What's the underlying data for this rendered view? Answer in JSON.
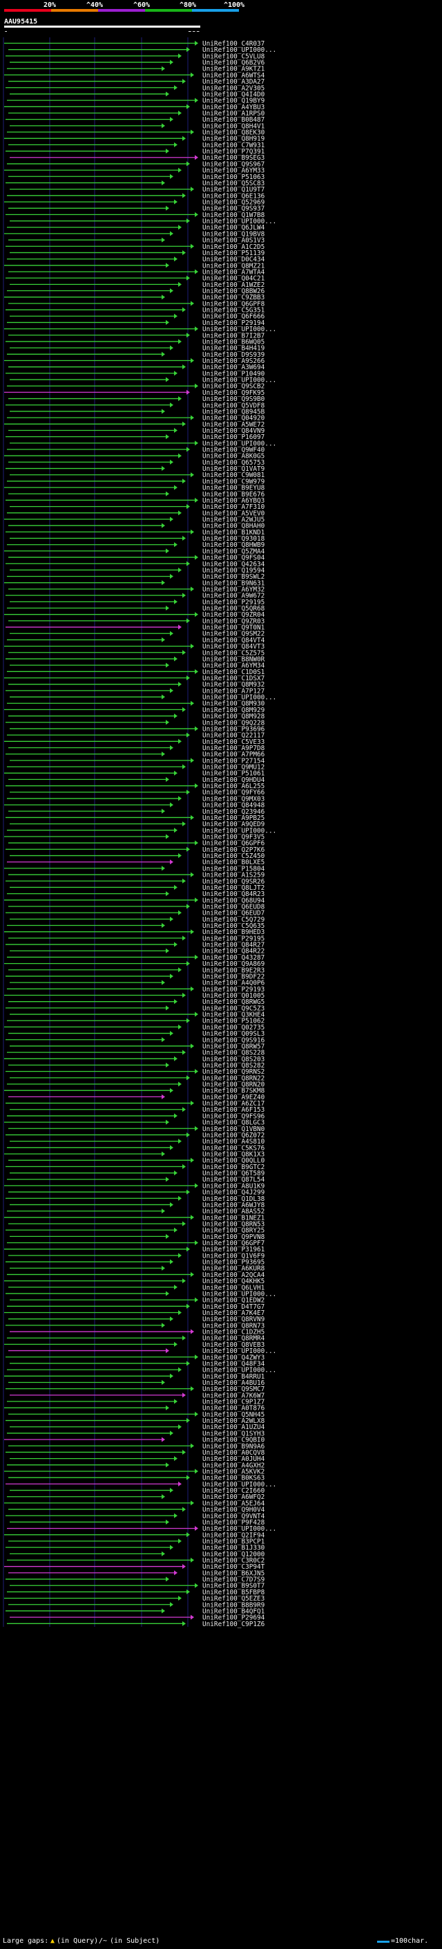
{
  "header": {
    "scale_labels": [
      "20%",
      "^40%",
      "^60%",
      "^80%",
      "^100%"
    ],
    "scale_colors": [
      "#e8001c",
      "#e87a00",
      "#9c1fd0",
      "#18b418",
      "#18a0e8"
    ],
    "query_id": "AAU95415",
    "query_start": "1",
    "query_end": "532"
  },
  "legend": {
    "large_gaps_label": "Large gaps:",
    "in_query_label": "(in Query)",
    "in_subject_label": "(in Subject)",
    "scale_label": "=100char."
  },
  "colors": {
    "green": "#38d238",
    "magenta": "#d23ad2",
    "gridline": "#1e1e78",
    "query_bar": "#ffffff"
  },
  "hits": [
    "UniRef100_C4R037",
    "UniRef100_UPI000...",
    "UniRef100_C5VLU8",
    "UniRef100_Q6B2V6",
    "UniRef100_A9KTZ1",
    "UniRef100_A6WTS4",
    "UniRef100_A3DA27",
    "UniRef100_A2V305",
    "UniRef100_Q4I4D0",
    "UniRef100_Q19BY9",
    "UniRef100_A4YBU3",
    "UniRef100_A1RPS0",
    "UniRef100_B0B487",
    "UniRef100_Q8H4V1",
    "UniRef100_Q8EK30",
    "UniRef100_Q8H919",
    "UniRef100_C7W931",
    "UniRef100_P7Q391",
    "UniRef100_B9SEG3",
    "UniRef100_Q9S967",
    "UniRef100_A6YM33",
    "UniRef100_P51063",
    "UniRef100_Q5SC83",
    "UniRef100_Q1U9T7",
    "UniRef100_Q6E136",
    "UniRef100_Q52969",
    "UniRef100_Q9S937",
    "UniRef100_Q1W7B8",
    "UniRef100_UPI000...",
    "UniRef100_Q6JLW4",
    "UniRef100_Q19BV8",
    "UniRef100_A0S1V3",
    "UniRef100_A1C2D5",
    "UniRef100_P51139",
    "UniRef100_D0C434",
    "UniRef100_Q8MZ21",
    "UniRef100_A7WTA4",
    "UniRef100_Q04C21",
    "UniRef100_A1WZE2",
    "UniRef100_Q8BW26",
    "UniRef100_C9ZBB3",
    "UniRef100_Q6GPF8",
    "UniRef100_C5G351",
    "UniRef100_Q6F666",
    "UniRef100_P29194",
    "UniRef100_UPI000...",
    "UniRef100_B7I2B7",
    "UniRef100_B6WQ05",
    "UniRef100_B4H419",
    "UniRef100_D9S939",
    "UniRef100_A9S266",
    "UniRef100_A3W694",
    "UniRef100_P10490",
    "UniRef100_UPI000...",
    "UniRef100_Q9SCB2",
    "UniRef100_Q9FK95",
    "UniRef100_Q9S9B0",
    "UniRef100_Q5VDF8",
    "UniRef100_Q8945B",
    "UniRef100_Q04920",
    "UniRef100_A5WE72",
    "UniRef100_Q84VN9",
    "UniRef100_P16097",
    "UniRef100_UPI000...",
    "UniRef100_Q9WF40",
    "UniRef100_A8K0G5",
    "UniRef100_Q65753",
    "UniRef100_Q1VAT9",
    "UniRef100_C9W081",
    "UniRef100_C9W979",
    "UniRef100_B9EYU8",
    "UniRef100_B9E676",
    "UniRef100_A6YBQ3",
    "UniRef100_A7F310",
    "UniRef100_A5VEV0",
    "UniRef100_A2WJU5",
    "UniRef100_Q8HAH0",
    "UniRef100_B1KND1",
    "UniRef100_Q93018",
    "UniRef100_Q8HWB9",
    "UniRef100_Q5ZMA4",
    "UniRef100_Q9FS04",
    "UniRef100_Q42634",
    "UniRef100_Q19594",
    "UniRef100_B9SWL2",
    "UniRef100_B9N631",
    "UniRef100_A6YM32",
    "UniRef100_A9W672",
    "UniRef100_P29195",
    "UniRef100_Q5QR68",
    "UniRef100_Q9ZR04",
    "UniRef100_Q9ZR03",
    "UniRef100_Q9T0N1",
    "UniRef100_Q9SM22",
    "UniRef100_Q84VT4",
    "UniRef100_Q84VT3",
    "UniRef100_C5Z575",
    "UniRef100_B8NW0R",
    "UniRef100_A6YM34",
    "UniRef100_C1D0S1",
    "UniRef100_C1DSX7",
    "UniRef100_Q8M932",
    "UniRef100_A7P127",
    "UniRef100_UPI000...",
    "UniRef100_Q8M930",
    "UniRef100_Q8M929",
    "UniRef100_Q8M928",
    "UniRef100_Q9Q228",
    "UniRef100_P93696",
    "UniRef100_Q22117",
    "UniRef100_C5VE33",
    "UniRef100_A9P7D8",
    "UniRef100_A7PM66",
    "UniRef100_P27154",
    "UniRef100_Q9MU12",
    "UniRef100_P51061",
    "UniRef100_Q9HDU4",
    "UniRef100_A6L255",
    "UniRef100_Q9FY66",
    "UniRef100_Q9MX03",
    "UniRef100_Q84948",
    "UniRef100_Q23946",
    "UniRef100_A9PB25",
    "UniRef100_A9QED9",
    "UniRef100_UPI000...",
    "UniRef100_Q9F3V5",
    "UniRef100_Q6GPF6",
    "UniRef100_Q2P7K6",
    "UniRef100_C5Z450",
    "UniRef100_B0LXE5",
    "UniRef100_P15804",
    "UniRef100_A1S259",
    "UniRef100_Q9SR26",
    "UniRef100_Q8LJT2",
    "UniRef100_Q84R23",
    "UniRef100_Q68U94",
    "UniRef100_Q6EUD8",
    "UniRef100_Q6EUD7",
    "UniRef100_C5Q729",
    "UniRef100_C5Q635",
    "UniRef100_B9HED3",
    "UniRef100_P29195",
    "UniRef100_Q84R27",
    "UniRef100_Q84R22",
    "UniRef100_Q43287",
    "UniRef100_Q9A869",
    "UniRef100_B9E2R3",
    "UniRef100_B9DF22",
    "UniRef100_A4Q0P6",
    "UniRef100_P29193",
    "UniRef100_Q01005",
    "UniRef100_Q8RWG5",
    "UniRef100_Q9C5Z3",
    "UniRef100_Q3KHE4",
    "UniRef100_P51062",
    "UniRef100_Q02735",
    "UniRef100_Q09SL3",
    "UniRef100_Q9S916",
    "UniRef100_Q8RW57",
    "UniRef100_Q8S228",
    "UniRef100_Q8S203",
    "UniRef100_Q8S282",
    "UniRef100_Q9RNS2",
    "UniRef100_Q8RN22",
    "UniRef100_Q8RN20",
    "UniRef100_B7SKM8",
    "UniRef100_A9EZ40",
    "UniRef100_A6ZC17",
    "UniRef100_A6F153",
    "UniRef100_Q9FS96",
    "UniRef100_Q8LGC3",
    "UniRef100_Q1VBN0",
    "UniRef100_Q6Z072",
    "UniRef100_A4S810",
    "UniRef100_C5KS76",
    "UniRef100_Q8K1X3",
    "UniRef100_Q0QLL0",
    "UniRef100_B9GTC2",
    "UniRef100_Q6T589",
    "UniRef100_Q87L54",
    "UniRef100_A8U1K9",
    "UniRef100_Q4J299",
    "UniRef100_Q1DL38",
    "UniRef100_A6WJY8",
    "UniRef100_A8AS52",
    "UniRef100_B1NEZ1",
    "UniRef100_Q8RN53",
    "UniRef100_Q8RY25",
    "UniRef100_Q9PVN8",
    "UniRef100_Q6GPF7",
    "UniRef100_P31961",
    "UniRef100_Q1V6F9",
    "UniRef100_P93695",
    "UniRef100_A6KUR8",
    "UniRef100_A2QCA4",
    "UniRef100_Q4KHK5",
    "UniRef100_Q6LVH1",
    "UniRef100_UPI000...",
    "UniRef100_Q1EDW2",
    "UniRef100_D4T7G7",
    "UniRef100_A7K4E7",
    "UniRef100_Q8RVN9",
    "UniRef100_Q8RN73",
    "UniRef100_C1DZH5",
    "UniRef100_Q8RMR4",
    "UniRef100_Q8VEB3",
    "UniRef100_UPI000...",
    "UniRef100_Q4ZWY3",
    "UniRef100_Q48F34",
    "UniRef100_UPI000...",
    "UniRef100_B4RRU1",
    "UniRef100_A4BU16",
    "UniRef100_Q9SMC7",
    "UniRef100_A7K6W7",
    "UniRef100_C9P1Z7",
    "UniRef100_A0T876",
    "UniRef100_Q5NH45",
    "UniRef100_A2WLX8",
    "UniRef100_A1UZU4",
    "UniRef100_Q1SYH3",
    "UniRef100_C9QBI0",
    "UniRef100_B9N9A6",
    "UniRef100_A0CQV8",
    "UniRef100_A0JUH4",
    "UniRef100_A4GXH2",
    "UniRef100_A5KVK2",
    "UniRef100_B0KS63",
    "UniRef100_UPI000...",
    "UniRef100_C2I660",
    "UniRef100_A6WFQ2",
    "UniRef100_A5EJ64",
    "UniRef100_Q9H0V4",
    "UniRef100_Q9VNT4",
    "UniRef100_P9F428",
    "UniRef100_UPI000...",
    "UniRef100_Q2IF94",
    "UniRef100_B3PCP1",
    "UniRef100_B1J330",
    "UniRef100_Q12000",
    "UniRef100_C3R0C2",
    "UniRef100_C3P94T",
    "UniRef100_B6XJN5",
    "UniRef100_C7D7S9",
    "UniRef100_B9S0T7",
    "UniRef100_B5FBP8",
    "UniRef100_Q5EZE3",
    "UniRef100_B8B9R9",
    "UniRef100_B4QFQ1",
    "UniRef100_P29694",
    "UniRef100_C9P1Z6"
  ]
}
